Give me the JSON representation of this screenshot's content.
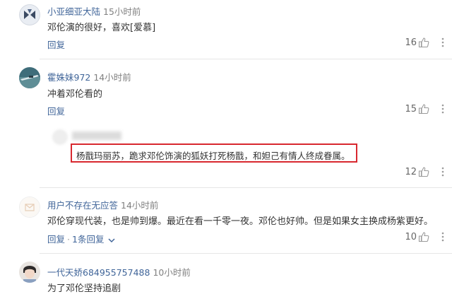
{
  "comments": [
    {
      "user": "小亚细亚大陆",
      "time": "15小时前",
      "text": "邓伦演的很好，喜欢[爱慕]",
      "reply_label": "回复",
      "likes": "16"
    },
    {
      "user": "霍姝妹972",
      "time": "14小时前",
      "text": "冲着邓伦看的",
      "reply_label": "回复",
      "likes": "15",
      "sub_reply": {
        "text": "杨戬玛丽苏，跪求邓伦饰演的狐妖打死杨戬，和妲己有情人终成眷属。",
        "likes": "12"
      }
    },
    {
      "user": "用户不存在无应答",
      "time": "14小时前",
      "text": "邓伦穿现代装，也是帅到爆。最近在看一千零一夜。邓伦也好帅。但是如果女主换成杨紫更好。",
      "reply_label": "回复",
      "separator": "·",
      "replies_label": "1条回复",
      "likes": "10"
    },
    {
      "user": "一代天娇684955757488",
      "time": "10小时前",
      "text": "为了邓伦坚持追剧"
    }
  ],
  "colors": {
    "username": "#406599",
    "highlight_border": "#d8282f"
  },
  "icons": [
    "thumb-up-icon",
    "more-vertical-icon",
    "chevron-down-icon"
  ]
}
